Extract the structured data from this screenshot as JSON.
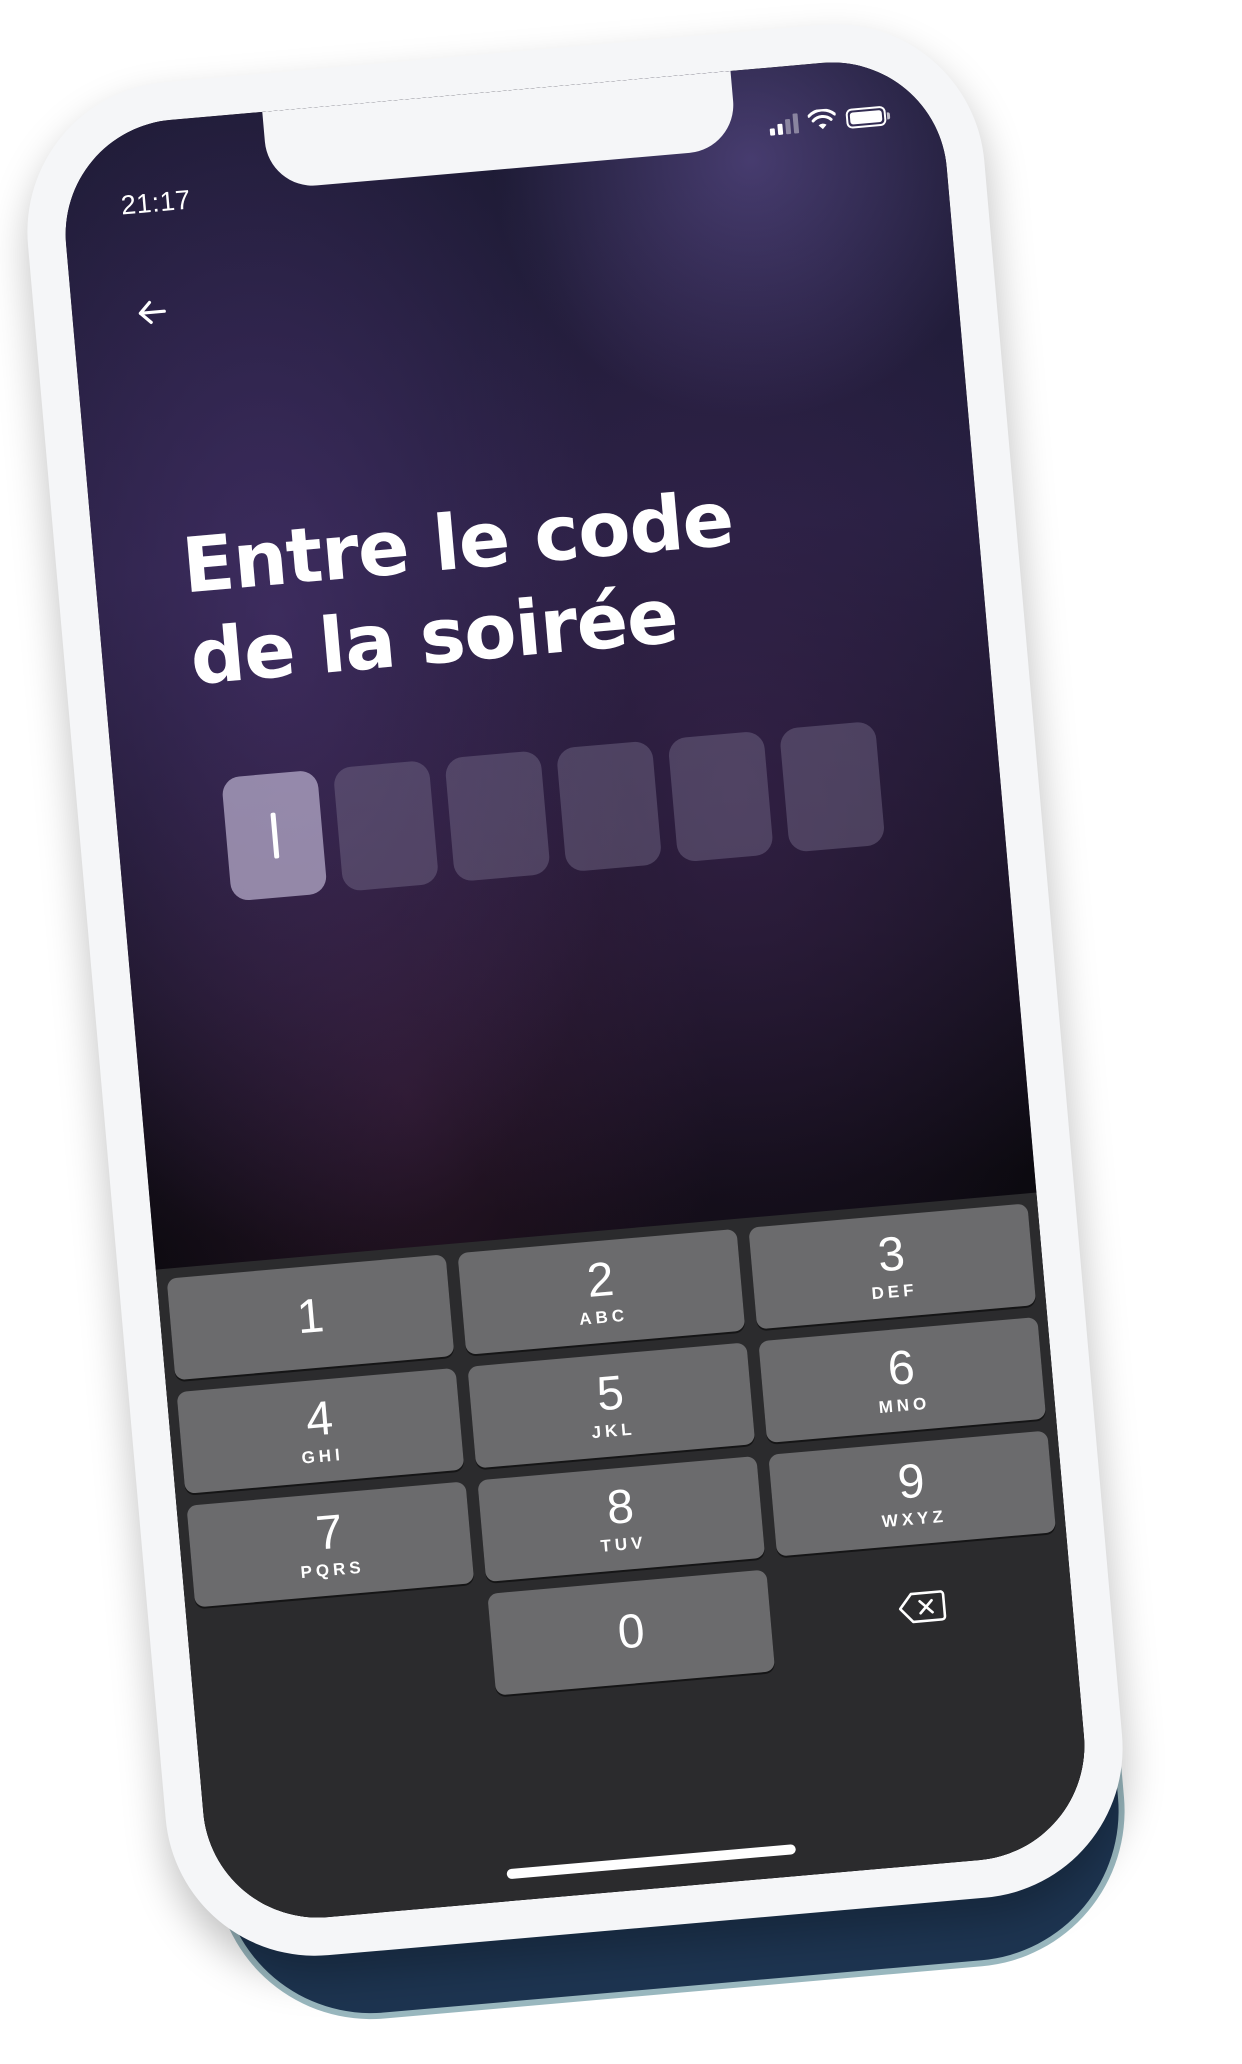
{
  "status_bar": {
    "time": "21:17",
    "signal_icon": "cellular-signal-icon",
    "wifi_icon": "wifi-icon",
    "battery_icon": "battery-icon"
  },
  "navigation": {
    "back_icon": "arrow-left-icon"
  },
  "heading": {
    "line1": "Entre le code",
    "line2": "de la soirée"
  },
  "code_input": {
    "length": 6,
    "active_index": 0,
    "value": ""
  },
  "keypad": {
    "keys": [
      {
        "digit": "1",
        "letters": ""
      },
      {
        "digit": "2",
        "letters": "ABC"
      },
      {
        "digit": "3",
        "letters": "DEF"
      },
      {
        "digit": "4",
        "letters": "GHI"
      },
      {
        "digit": "5",
        "letters": "JKL"
      },
      {
        "digit": "6",
        "letters": "MNO"
      },
      {
        "digit": "7",
        "letters": "PQRS"
      },
      {
        "digit": "8",
        "letters": "TUV"
      },
      {
        "digit": "9",
        "letters": "WXYZ"
      },
      {
        "digit": "0",
        "letters": ""
      }
    ],
    "delete_icon": "backspace-icon"
  },
  "colors": {
    "key_background": "#6b6b6d",
    "keyboard_background": "#2b2b2d",
    "phone_frame": "#f5f6f8",
    "shadow": "#1d3450"
  }
}
